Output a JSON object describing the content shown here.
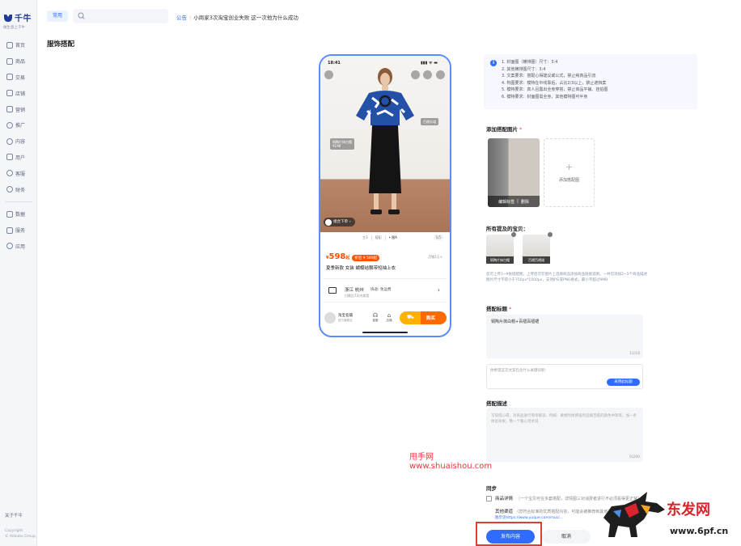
{
  "sidebar": {
    "logo": {
      "brand": "千牛",
      "slogan": "做生意上千牛"
    },
    "items": [
      {
        "label": "首页",
        "icon": "home-icon"
      },
      {
        "label": "商品",
        "icon": "product-icon"
      },
      {
        "label": "交易",
        "icon": "trade-icon"
      },
      {
        "label": "店铺",
        "icon": "shop-icon"
      },
      {
        "label": "营销",
        "icon": "marketing-icon"
      },
      {
        "label": "推广",
        "icon": "promote-icon"
      },
      {
        "label": "内容",
        "icon": "content-icon"
      },
      {
        "label": "用户",
        "icon": "user-icon"
      },
      {
        "label": "客服",
        "icon": "service-icon"
      },
      {
        "label": "财务",
        "icon": "finance-icon"
      }
    ],
    "items2": [
      {
        "label": "数据",
        "icon": "data-icon"
      },
      {
        "label": "服务",
        "icon": "service-market-icon"
      },
      {
        "label": "应用",
        "icon": "apps-icon"
      }
    ],
    "about": "关于千牛",
    "copyright": [
      "Copyright",
      "© Alibaba Group"
    ]
  },
  "topbar": {
    "tab": "常用",
    "announce_tag": "公告",
    "announce_msg": "小商家3次淘宝创业失败 这一次他为什么成功"
  },
  "page_title": "服饰搭配",
  "phone": {
    "time": "18:41",
    "signal": "▮▮▮ ᯤ ▬",
    "tag1_line1": "铜陶片抹白帽",
    "tag1_line2": "¥198",
    "tag2": "百褶半裙",
    "add_cart": "组合下单",
    "thumbs": [
      "主3",
      "搭配",
      "• 图A"
    ],
    "page": "1/5",
    "price": "598",
    "price_unit": "起",
    "coupon": "折后 ¥ 589起",
    "sold": "月销1万+",
    "title": "夏季新款 女装 蝴蝶结飘带短袖上衣",
    "ship_loc": "浙江 杭州",
    "ship_freight": "快递: 免运费",
    "ship_eta": "付款后7天内发货",
    "shop_name": "淘宝名铺",
    "shop_sub": "官方旗舰店",
    "b1": "客服",
    "b2": "店铺",
    "buy": "购买"
  },
  "tips": [
    "1. 封面图（横排图）尺寸：3:4",
    "2. 其他横排图尺寸：3:4",
    "3. 文案要求：搭配心得建议或公式，禁止纯商品引流",
    "4. 构图要求：模特在中线靠后，占比2/3以上，禁止遮挡案",
    "5. 模特要求：真人且露出全身穿搭，禁止商品平铺、挂拍图",
    "6. 模特要求：封面图需全身，其他模特图可半身"
  ],
  "add_image": {
    "title": "添加搭配图片",
    "required": "*",
    "edit_tag": "编辑标签",
    "delete": "删除",
    "add_label": "添加搭配图"
  },
  "items_section": {
    "title": "所有提及的宝贝：",
    "items": [
      {
        "caption": "铜陶片抹白帽"
      },
      {
        "caption": "百褶百褶裙"
      }
    ],
    "desc": "您可上传1~9张搭配图，上传后可在图片上选择商品添加商品链接说明，一共可添加2~5个商品描述 图片尺寸不得小于750px*1000px，支持JPG或PNG格式，最小不超过9MB"
  },
  "title_section": {
    "title": "搭配标题",
    "required": "*",
    "value": "铜陶片抹白帽+百褶百褶裙",
    "count": "11/18",
    "ai_placeholder": "你希望这次文案包含什么关键词呢：",
    "ai_button": "采用此标题"
  },
  "desc_section": {
    "title": "搭配描述",
    "placeholder": "写穿搭心得，对商品进行简单解读，例如：要想时尚感强烈选择百搭的颜色中等等，加一条体验效果，整一个暖心话术说",
    "count": "0/200"
  },
  "sync": {
    "title": "同步",
    "row1_key": "商品详情",
    "row1_desc": "（一个宝贝可在多套搭配，详情图三对消费者进行不必须看得更正常）",
    "row2_key": "其他渠道",
    "row2_desc": "（您符合标准的优质搭配内容，可能会被推荐到其他渠道进行分发与展示）",
    "row3": "图示见https://www.yuque.com/rnuc/..."
  },
  "buttons": {
    "publish": "发布内容",
    "cancel": "取消"
  },
  "watermarks": {
    "w1": "甩手网",
    "w2": "www.shuaishou.com",
    "w3": "东发网",
    "w4": "www.6pf.cn"
  },
  "colors": {
    "accent": "#2f6bff",
    "price": "#ff5000",
    "highlight": "#e53935"
  }
}
